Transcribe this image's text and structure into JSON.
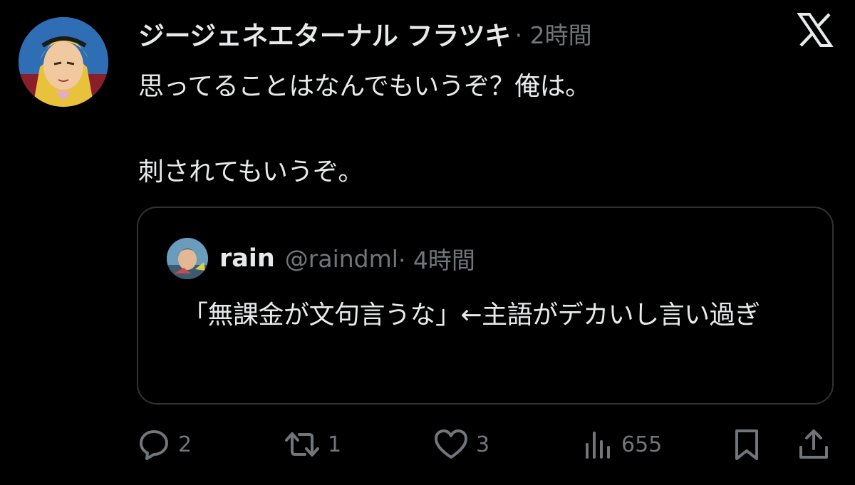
{
  "post": {
    "display_name": "ジージェネエターナル フラツキ",
    "timestamp": "· 2時間",
    "text_line1": "思ってることはなんでもいうぞ？俺は。",
    "text_line2": "刺されてもいうぞ。"
  },
  "quote": {
    "name": "rain",
    "handle": "@raindml",
    "timestamp": "· 4時間",
    "text": "「無課金が文句言うな」←主語がデカいし言い過ぎ"
  },
  "actions": {
    "replies": "2",
    "reposts": "1",
    "likes": "3",
    "views": "655"
  },
  "icons": {
    "logo": "x-logo-icon",
    "reply": "reply-icon",
    "repost": "repost-icon",
    "like": "heart-icon",
    "views": "views-icon",
    "bookmark": "bookmark-icon",
    "share": "share-icon"
  },
  "colors": {
    "background": "#000000",
    "text": "#e7e9ea",
    "secondary": "#71767b",
    "border": "#2f3336"
  }
}
